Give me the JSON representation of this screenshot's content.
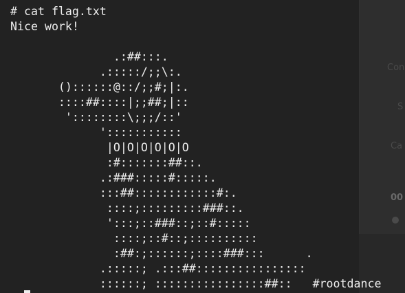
{
  "terminal": {
    "lines": [
      "#",
      "# cat flag.txt",
      "Nice work!",
      "",
      "               .:##:::.",
      "             .:::::/;;\\:.",
      "       ()::::::@::/;;#;|:.",
      "       ::::##::::|;;##;|::",
      "        '::::::::\\;;;/::'",
      "             ':::::::::::",
      "              |O|O|O|O|O|O",
      "              :#:::::::##::.",
      "             .:###:::::#:::::.",
      "             :::##::::::::::::#:.",
      "              ::::;:::::::::###::.",
      "              ':::;::###::;::#:::::",
      "               ::::;::#::;::::::::::",
      "               :##:;::::::;::::###:::      .",
      "             .:::::; .:::##::::::::::::::::",
      "             ::::::; ::::::::::::::::##::   #rootdance"
    ]
  },
  "background_window": {
    "texts": [
      "Con",
      "S",
      "Ca",
      "00"
    ]
  }
}
